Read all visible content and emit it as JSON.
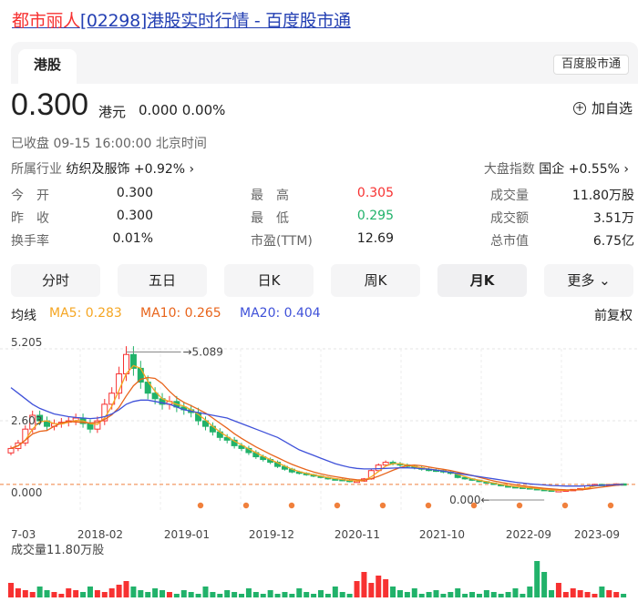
{
  "header": {
    "title_name": "都市丽人",
    "title_rest": "[02298]港股实时行情 - 百度股市通"
  },
  "tabs": {
    "market_tab": "港股",
    "baidu_btn": "百度股市通"
  },
  "quote": {
    "price": "0.300",
    "unit": "港元",
    "change": "0.000 0.00%",
    "add_watch": "加自选",
    "status": "已收盘  09-15 16:00:00  北京时间",
    "industry_label": "所属行业",
    "industry_value": "纺织及服饰 +0.92% ›",
    "index_label": "大盘指数",
    "index_value": "国企 +0.55% ›"
  },
  "stats": [
    {
      "label": "今　开",
      "value": "0.300",
      "color": "#222222"
    },
    {
      "label": "最　高",
      "value": "0.305",
      "color": "#f73131"
    },
    {
      "label": "成交量",
      "value": "11.80万股",
      "color": "#222222"
    },
    {
      "label": "昨　收",
      "value": "0.300",
      "color": "#222222"
    },
    {
      "label": "最　低",
      "value": "0.295",
      "color": "#21b26a"
    },
    {
      "label": "成交额",
      "value": "3.51万",
      "color": "#222222"
    },
    {
      "label": "换手率",
      "value": "0.01%",
      "color": "#222222"
    },
    {
      "label": "市盈(TTM)",
      "value": "12.69",
      "color": "#222222"
    },
    {
      "label": "总市值",
      "value": "6.75亿",
      "color": "#222222"
    }
  ],
  "periods": [
    "分时",
    "五日",
    "日K",
    "周K",
    "月K",
    "更多"
  ],
  "active_period": "月K",
  "ma": {
    "label": "均线",
    "ma5": "MA5: 0.283",
    "ma10": "MA10: 0.265",
    "ma20": "MA20: 0.404",
    "adjust": "前复权",
    "colors": {
      "ma5": "#f5a623",
      "ma10": "#e8641b",
      "ma20": "#3f51d9"
    }
  },
  "colors": {
    "up": "#f73131",
    "down": "#21b26a",
    "link": "#2440b3"
  },
  "chart_data": {
    "type": "candlestick",
    "y_top_label": "5.205",
    "y_mid_label": "2.603",
    "y_bottom_label": "0.000",
    "max_annotation": "5.089",
    "min_annotation": "0.000",
    "x_labels": [
      "7-03",
      "2018-02",
      "2019-01",
      "2019-12",
      "2020-11",
      "2021-10",
      "2022-09",
      "2023-09"
    ],
    "ylim": [
      0,
      5.205
    ],
    "close_series": [
      1.6,
      1.8,
      2.3,
      2.8,
      2.6,
      2.4,
      2.5,
      2.55,
      2.6,
      2.7,
      2.5,
      2.3,
      2.6,
      3.2,
      3.6,
      4.3,
      5.0,
      4.5,
      4.0,
      3.6,
      3.4,
      3.2,
      3.3,
      3.1,
      3.0,
      2.9,
      2.6,
      2.4,
      2.2,
      2.0,
      1.9,
      1.7,
      1.6,
      1.45,
      1.3,
      1.2,
      1.1,
      0.95,
      0.85,
      0.75,
      0.7,
      0.65,
      0.6,
      0.55,
      0.5,
      0.48,
      0.45,
      0.4,
      0.42,
      0.5,
      0.8,
      1.0,
      1.1,
      1.05,
      1.0,
      0.95,
      0.9,
      0.85,
      0.82,
      0.8,
      0.75,
      0.7,
      0.55,
      0.5,
      0.45,
      0.4,
      0.35,
      0.3,
      0.25,
      0.22,
      0.2,
      0.18,
      0.15,
      0.12,
      0.1,
      0.08,
      0.08,
      0.1,
      0.12,
      0.15,
      0.25,
      0.3,
      0.28,
      0.3,
      0.32,
      0.3
    ],
    "ma20_series": [
      3.8,
      3.6,
      3.4,
      3.2,
      3.05,
      2.95,
      2.85,
      2.8,
      2.75,
      2.72,
      2.7,
      2.68,
      2.7,
      2.75,
      2.85,
      3.0,
      3.2,
      3.3,
      3.35,
      3.35,
      3.3,
      3.25,
      3.2,
      3.1,
      3.0,
      2.95,
      2.9,
      2.85,
      2.8,
      2.75,
      2.7,
      2.6,
      2.5,
      2.4,
      2.3,
      2.2,
      2.1,
      2.0,
      1.85,
      1.7,
      1.55,
      1.45,
      1.35,
      1.25,
      1.15,
      1.05,
      0.98,
      0.92,
      0.88,
      0.86,
      0.86,
      0.87,
      0.88,
      0.89,
      0.9,
      0.9,
      0.89,
      0.87,
      0.85,
      0.82,
      0.78,
      0.74,
      0.7,
      0.66,
      0.62,
      0.58,
      0.54,
      0.5,
      0.46,
      0.42,
      0.38,
      0.35,
      0.32,
      0.3,
      0.28,
      0.26,
      0.25,
      0.24,
      0.24,
      0.24,
      0.25,
      0.26,
      0.27,
      0.28,
      0.29,
      0.3
    ],
    "volume_label": "成交量11.80万股",
    "volume": [
      8,
      5,
      4,
      3,
      6,
      4,
      3,
      2,
      5,
      4,
      3,
      6,
      4,
      3,
      5,
      7,
      9,
      6,
      4,
      3,
      5,
      4,
      3,
      2,
      4,
      3,
      2,
      6,
      3,
      2,
      4,
      3,
      2,
      5,
      3,
      2,
      4,
      2,
      3,
      2,
      5,
      3,
      2,
      4,
      2,
      6,
      3,
      2,
      9,
      14,
      8,
      12,
      10,
      6,
      4,
      3,
      5,
      2,
      3,
      4,
      2,
      3,
      5,
      2,
      3,
      2,
      4,
      3,
      2,
      3,
      5,
      2,
      6,
      20,
      14,
      4,
      8,
      3,
      5,
      4,
      3,
      2,
      6,
      4,
      3,
      2
    ]
  }
}
